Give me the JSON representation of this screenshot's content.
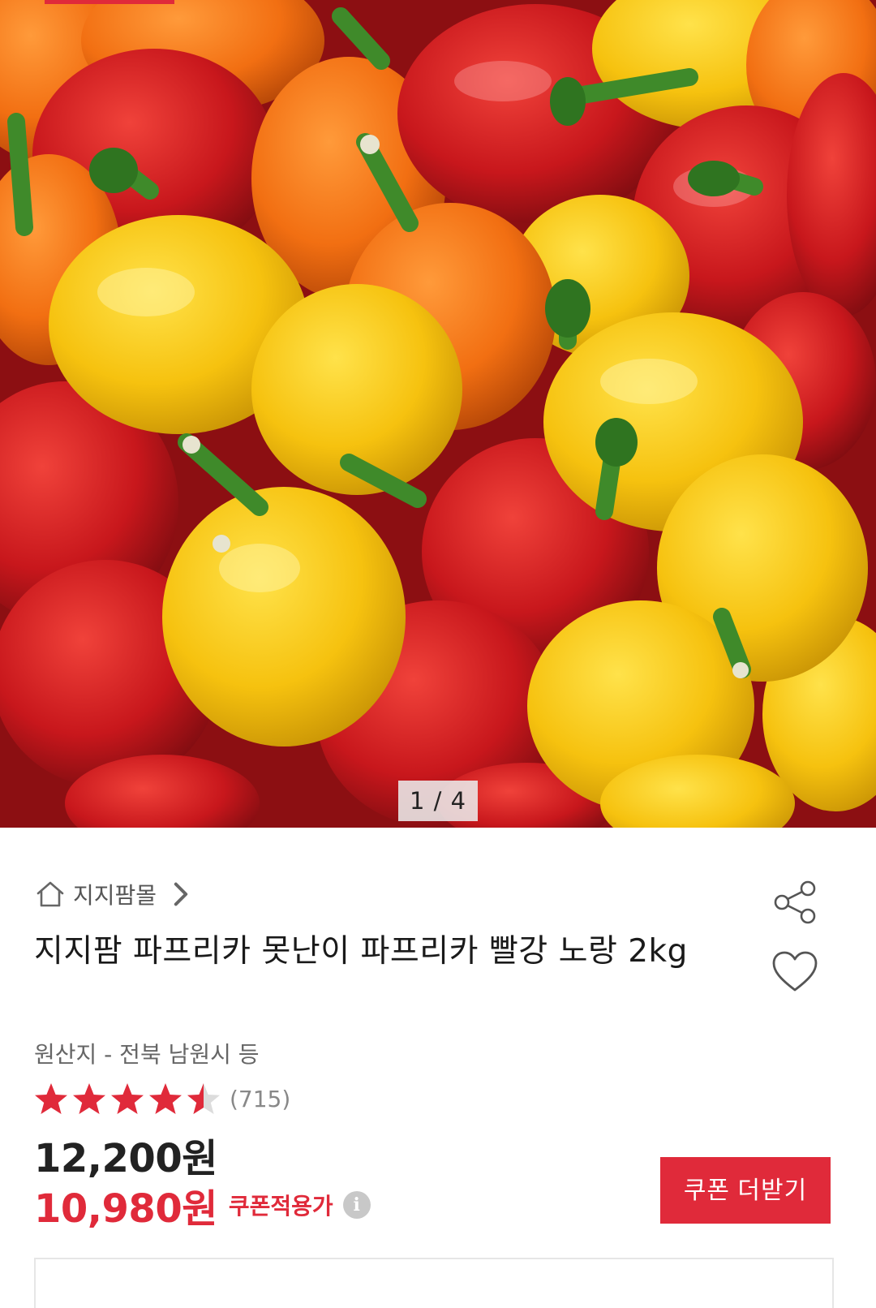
{
  "gallery": {
    "current": 1,
    "total": 4,
    "counter_label": "1 / 4"
  },
  "store": {
    "icon": "home-icon",
    "name": "지지팜몰",
    "chevron": "chevron-right-icon"
  },
  "product": {
    "title": "지지팜 파프리카 못난이 파프리카 빨강 노랑 2kg",
    "origin": "원산지 - 전북 남원시 등"
  },
  "rating": {
    "stars": 4.5,
    "max": 5,
    "review_count": "(715)"
  },
  "price": {
    "original": "12,200원",
    "sale": "10,980원",
    "sale_label": "쿠폰적용가",
    "info_icon_glyph": "i"
  },
  "actions": {
    "coupon_button": "쿠폰 더받기",
    "share_icon": "share-icon",
    "wishlist_icon": "heart-icon"
  },
  "colors": {
    "accent": "#e02a3a",
    "text": "#222222",
    "muted": "#666666"
  }
}
